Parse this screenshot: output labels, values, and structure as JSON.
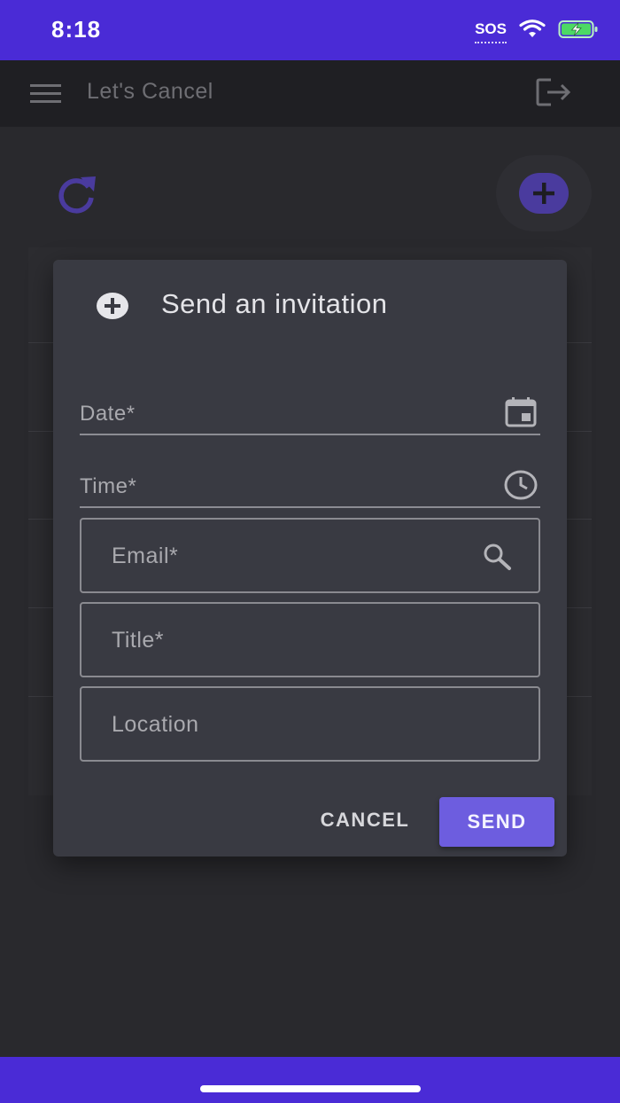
{
  "status_bar": {
    "time": "8:18",
    "sos": "SOS",
    "wifi_icon": "wifi-icon",
    "battery_icon": "battery-charging-icon",
    "battery_color": "#4cd964"
  },
  "app_bar": {
    "title": "Let's Cancel",
    "menu_icon": "menu-icon",
    "logout_icon": "logout-icon"
  },
  "page": {
    "refresh_icon": "refresh-icon",
    "add_icon": "add-circle-icon"
  },
  "dialog": {
    "title": "Send an invitation",
    "title_icon": "add-circle-icon",
    "fields": {
      "date": {
        "label": "Date*",
        "icon": "calendar-icon"
      },
      "time": {
        "label": "Time*",
        "icon": "clock-icon"
      },
      "email": {
        "label": "Email*",
        "icon": "search-icon"
      },
      "title": {
        "label": "Title*"
      },
      "location": {
        "label": "Location"
      }
    },
    "actions": {
      "cancel_label": "CANCEL",
      "send_label": "SEND"
    }
  },
  "colors": {
    "brand": "#4a2bd6",
    "accent": "#6d5ddf",
    "dialog_bg": "#393a42",
    "background": "#2a2a2e"
  }
}
